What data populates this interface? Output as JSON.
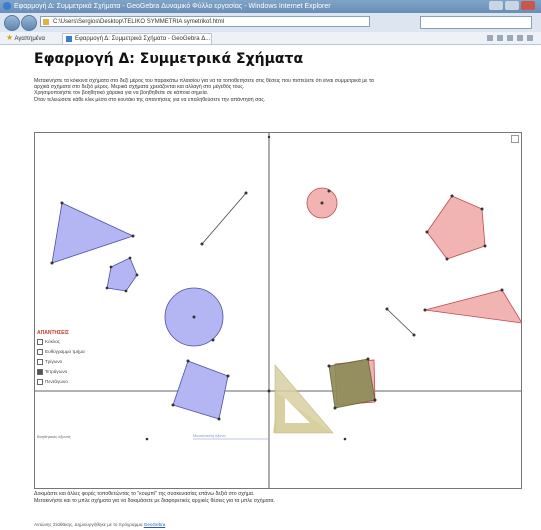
{
  "window": {
    "title": "Εφαρμογή Δ: Συμμετρικά Σχήματα - GeoGebra Δυναμικό Φύλλο εργασίας - Windows Internet Explorer"
  },
  "address_bar": {
    "url": "C:\\Users\\Sergios\\Desktop\\TELIKO SYMMETRIA symetrikof.html"
  },
  "favorites_bar": {
    "favorites_label": "Αγαπημένα",
    "tab_label": "Εφαρμογή Δ: Συμμετρικά Σχήματα - GeoGebra Δ..."
  },
  "page": {
    "title": "Εφαρμογή Δ: Συμμετρικά Σχήματα",
    "instructions": [
      "Μετακινήστε τα κόκκινα σχήματα στο δεξί μέρος του παρακάτω πλαισίου για να τα τοποθετήσετε στις θέσεις που πιστεύετε ότι είναι συμμετρικά με τα",
      "αρχικά σχήματα στο δεξιό μέρος.  Μερικά σχήματα χρειάζονται και αλλαγή στο μέγεθός τους.",
      "Χρησιμοποιήστε τον βοηθητικό χάρακα για να βοηθηθείτε σε κάποια σημεία.",
      "Όταν τελειώσετε κάθε κλικ μέσα στο κουτάκι της απαντήσεις για να επαληθεύσετε την απάντησή σας."
    ],
    "bottom_text": [
      "Δοκιμάστε και άλλες φορές τοποθετώντας το \"κουμπί\" της συσκευασίας επάνω δεξιά στο σχήμα.",
      "Μετακινήστε και το μπλε σχήματα για να δοκιμάσετε με διαφορετικές αρχικές θέσεις για τα μπλε σχήματα."
    ],
    "credit_prefix": "Αντώνης Σταθάκης, Δημιουργήθηκε με το πρόγραμμα",
    "credit_link": "GeoGebra"
  },
  "applet": {
    "answers_header": "ΑΠΑΝΤΗΣΕΙΣ",
    "answers": [
      {
        "label": "Κύκλος",
        "checked": false
      },
      {
        "label": "Ευθύγραμμο τμήμα",
        "checked": false
      },
      {
        "label": "Τρίγωνο",
        "checked": false
      },
      {
        "label": "Τετράγωνο",
        "checked": true
      },
      {
        "label": "Πεντάγωνο",
        "checked": false
      }
    ],
    "coords_label": "Βοηθητικός άξονας",
    "slider_label": "Μετατόπιση άξονα",
    "colors": {
      "blue_fill": "#b3b6f2",
      "blue_stroke": "#4b4fa8",
      "red_fill": "#f2b3b3",
      "red_stroke": "#c04a4a",
      "olive_fill": "#8c8a55",
      "ruler_fill": "#d9cfa0"
    }
  }
}
